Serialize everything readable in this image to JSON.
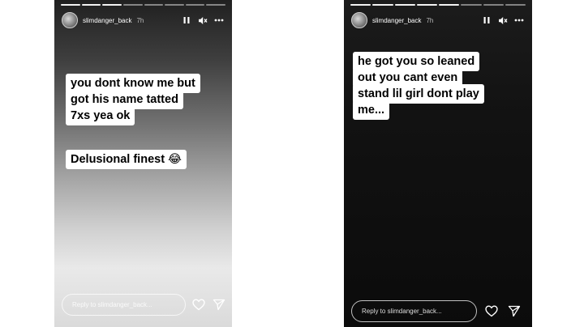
{
  "stories": [
    {
      "username": "slimdanger_back",
      "time": "7h",
      "progress": {
        "segments": 8,
        "completed": 3
      },
      "caption_blocks": [
        [
          "you dont know me but",
          "got his name tatted",
          "7xs yea ok"
        ],
        [
          "Delusional finest 😂"
        ]
      ],
      "reply_placeholder": "Reply to slimdanger_back...",
      "icons": {
        "pause": "pause-icon",
        "mute": "mute-icon",
        "more": "more-icon",
        "like": "heart-icon",
        "share": "send-icon"
      }
    },
    {
      "username": "slimdanger_back",
      "time": "7h",
      "progress": {
        "segments": 8,
        "completed": 5
      },
      "caption_blocks": [
        [
          "he got you so leaned",
          "out you cant even",
          "stand lil girl dont play",
          "me..."
        ]
      ],
      "reply_placeholder": "Reply to slimdanger_back...",
      "icons": {
        "pause": "pause-icon",
        "mute": "mute-icon",
        "more": "more-icon",
        "like": "heart-icon",
        "share": "send-icon"
      }
    }
  ]
}
